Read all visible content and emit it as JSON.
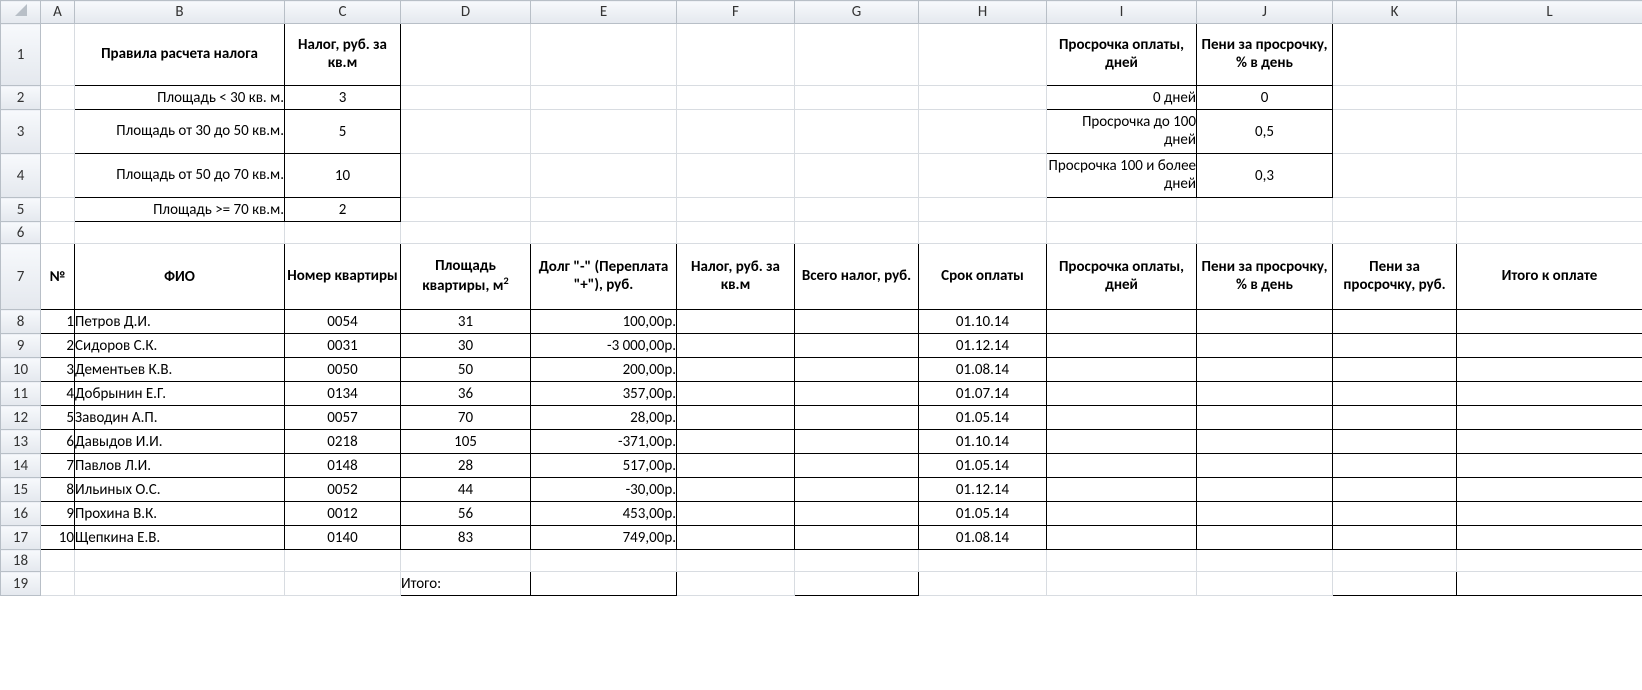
{
  "cols": [
    "A",
    "B",
    "C",
    "D",
    "E",
    "F",
    "G",
    "H",
    "I",
    "J",
    "K",
    "L"
  ],
  "rows": [
    "1",
    "2",
    "3",
    "4",
    "5",
    "6",
    "7",
    "8",
    "9",
    "10",
    "11",
    "12",
    "13",
    "14",
    "15",
    "16",
    "17",
    "18",
    "19"
  ],
  "rules": {
    "header_b": "Правила расчета налога",
    "header_c": "Налог, руб. за кв.м",
    "r2_b": "Площадь < 30 кв. м.",
    "r2_c": "3",
    "r3_b": "Площадь от 30 до 50 кв.м.",
    "r3_c": "5",
    "r4_b": "Площадь от 50 до 70 кв.м.",
    "r4_c": "10",
    "r5_b": "Площадь >= 70 кв.м.",
    "r5_c": "2"
  },
  "delay": {
    "header_i": "Просрочка оплаты, дней",
    "header_j": "Пени за просрочку, % в день",
    "r2_i": "0 дней",
    "r2_j": "0",
    "r3_i": "Просрочка до 100 дней",
    "r3_j": "0,5",
    "r4_i": "Просрочка 100 и более дней",
    "r4_j": "0,3"
  },
  "tbl": {
    "h_a": "№",
    "h_b": "ФИО",
    "h_c": "Номер квартиры",
    "h_d_pre": "Площадь квартиры, м",
    "h_d_sup": "2",
    "h_e": "Долг \"-\" (Переплата \"+\"), руб.",
    "h_f": "Налог, руб. за кв.м",
    "h_g": "Всего налог, руб.",
    "h_h": "Срок оплаты",
    "h_i": "Просрочка оплаты, дней",
    "h_j": "Пени за просрочку, % в день",
    "h_k": "Пени за просрочку, руб.",
    "h_l": "Итого к оплате"
  },
  "data": [
    {
      "n": "1",
      "fio": "Петров Д.И.",
      "num": "0054",
      "area": "31",
      "debt": "100,00р.",
      "due": "01.10.14"
    },
    {
      "n": "2",
      "fio": "Сидоров С.К.",
      "num": "0031",
      "area": "30",
      "debt": "-3 000,00р.",
      "due": "01.12.14"
    },
    {
      "n": "3",
      "fio": "Дементьев К.В.",
      "num": "0050",
      "area": "50",
      "debt": "200,00р.",
      "due": "01.08.14"
    },
    {
      "n": "4",
      "fio": "Добрынин Е.Г.",
      "num": "0134",
      "area": "36",
      "debt": "357,00р.",
      "due": "01.07.14"
    },
    {
      "n": "5",
      "fio": "Заводин А.П.",
      "num": "0057",
      "area": "70",
      "debt": "28,00р.",
      "due": "01.05.14"
    },
    {
      "n": "6",
      "fio": "Давыдов И.И.",
      "num": "0218",
      "area": "105",
      "debt": "-371,00р.",
      "due": "01.10.14"
    },
    {
      "n": "7",
      "fio": "Павлов Л.И.",
      "num": "0148",
      "area": "28",
      "debt": "517,00р.",
      "due": "01.05.14"
    },
    {
      "n": "8",
      "fio": "Ильиных О.С.",
      "num": "0052",
      "area": "44",
      "debt": "-30,00р.",
      "due": "01.12.14"
    },
    {
      "n": "9",
      "fio": "Прохина В.К.",
      "num": "0012",
      "area": "56",
      "debt": "453,00р.",
      "due": "01.05.14"
    },
    {
      "n": "10",
      "fio": "Щепкина Е.В.",
      "num": "0140",
      "area": "83",
      "debt": "749,00р.",
      "due": "01.08.14"
    }
  ],
  "total_label": "Итого:"
}
